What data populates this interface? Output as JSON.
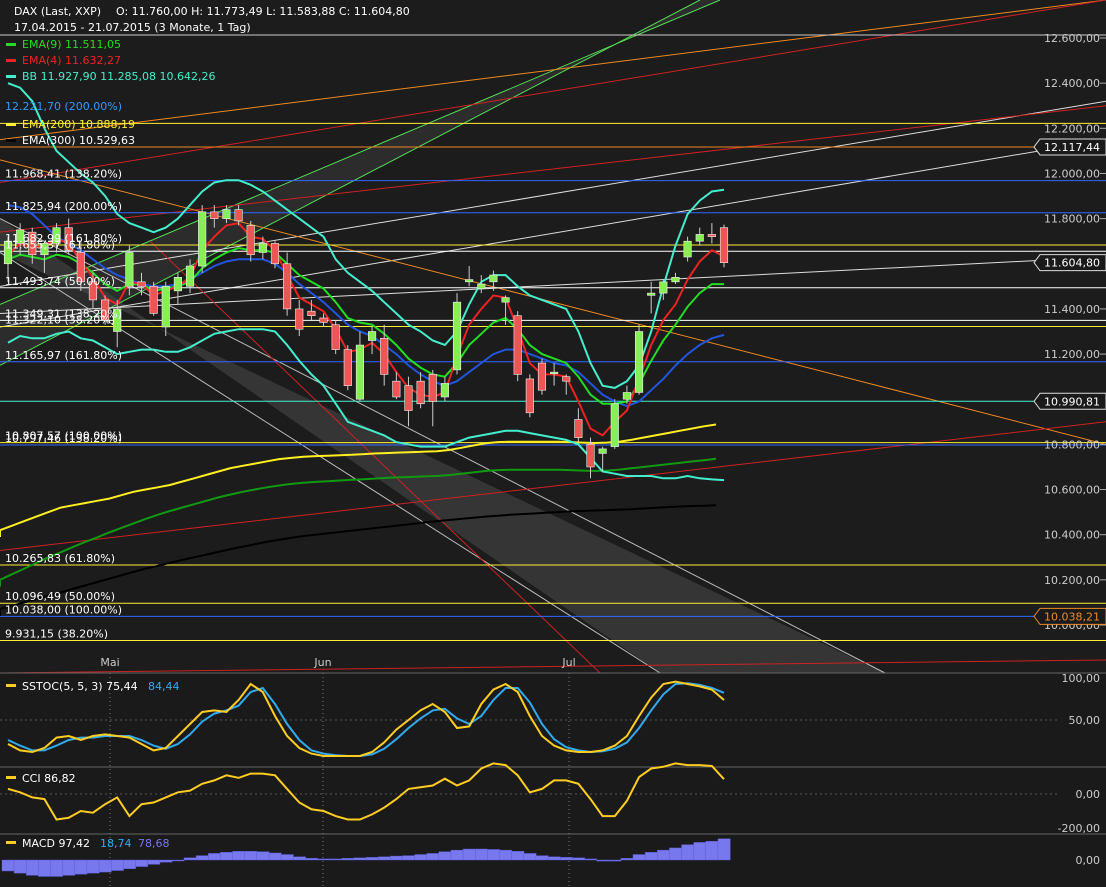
{
  "header": {
    "symbol": "DAX (Last, XXP)",
    "ohlc": "O: 11.760,00  H: 11.773,49  L: 11.583,88  C: 11.604,80",
    "period": "17.04.2015 - 21.07.2015 (3 Monate, 1 Tag)"
  },
  "legend": [
    {
      "label": "EMA(9)",
      "value": "11.511,05",
      "color": "#22dd22"
    },
    {
      "label": "EMA(4)",
      "value": "11.632,27",
      "color": "#ee2222"
    },
    {
      "label": "BB",
      "value": "11.927,90",
      "value2": "11.285,08",
      "value3": "10.642,26",
      "color": "#44eecc"
    },
    {
      "label": "EMA(200)",
      "value": "10.888,19",
      "color": "#ffee33"
    },
    {
      "label": "EMA(300)",
      "value": "10.529,63",
      "color": "#111111"
    }
  ],
  "legend_extra": "12.221,70 (200.00%)",
  "level_labels": [
    "11.968,41 (138.20%)",
    "11.825,94 (200.00%)",
    "11.682,99 (161.80%)",
    "11.655,37 (61.80%)",
    "11.493,74 (50.00%)",
    "11.349,31 (138.20%)",
    "11.322,10 (38.20%)",
    "11.165,97 (161.80%)",
    "10.807,57 (100.00%)",
    "10.797,46 (138.20%)",
    "10.265,83 (61.80%)",
    "10.096,49 (50.00%)",
    "10.038,00 (100.00%)",
    "9.931,15 (38.20%)"
  ],
  "price_boxes": [
    {
      "value": "12.117,44",
      "price": 12117.44
    },
    {
      "value": "11.604,80",
      "price": 11604.8
    },
    {
      "value": "10.990,81",
      "price": 10990.81
    },
    {
      "value": "10.038,21",
      "price": 10038.21
    }
  ],
  "months": [
    "Mai",
    "Jun",
    "Jul"
  ],
  "indicators": {
    "sstoc": {
      "label": "SSTOC(5, 5, 3)",
      "v1": "75,44",
      "v2": "84,44",
      "ticks": [
        "100,00",
        "50,00"
      ]
    },
    "cci": {
      "label": "CCI",
      "v1": "86,82",
      "ticks": [
        "0,00",
        "-200,00"
      ]
    },
    "macd": {
      "label": "MACD",
      "v1": "97,42",
      "v2": "18,74",
      "v3": "78,68",
      "ticks": [
        "0,00"
      ]
    }
  },
  "chart_data": {
    "type": "candlestick",
    "title": "DAX (Last, XXP)",
    "ylim": [
      9800,
      12800
    ],
    "yticks": [
      "12.600,00",
      "12.400,00",
      "12.200,00",
      "12.000,00",
      "11.800,00",
      "11.600,00",
      "11.400,00",
      "11.200,00",
      "11.000,00",
      "10.800,00",
      "10.600,00",
      "10.400,00",
      "10.200,00",
      "10.000,00"
    ],
    "horizontal_levels": [
      {
        "price": 12221.7,
        "color": "#ffee33"
      },
      {
        "price": 12117.44,
        "color": "#ee8822"
      },
      {
        "price": 11968.41,
        "color": "#3366ff"
      },
      {
        "price": 11825.94,
        "color": "#3366ff"
      },
      {
        "price": 11682.99,
        "color": "#ffee33"
      },
      {
        "price": 11655.37,
        "color": "#ffffff"
      },
      {
        "price": 11493.74,
        "color": "#ffffff"
      },
      {
        "price": 11349.31,
        "color": "#ffffff"
      },
      {
        "price": 11322.1,
        "color": "#ffee33"
      },
      {
        "price": 11165.97,
        "color": "#3366ff"
      },
      {
        "price": 10990.81,
        "color": "#44eecc"
      },
      {
        "price": 10807.57,
        "color": "#ffee33"
      },
      {
        "price": 10797.46,
        "color": "#3366ff"
      },
      {
        "price": 10265.83,
        "color": "#ffee33"
      },
      {
        "price": 10096.49,
        "color": "#ffee33"
      },
      {
        "price": 10038.0,
        "color": "#3366ff"
      },
      {
        "price": 9931.15,
        "color": "#ffee33"
      }
    ],
    "candles": [
      {
        "o": 11600,
        "h": 11720,
        "l": 11520,
        "c": 11700
      },
      {
        "o": 11690,
        "h": 11780,
        "l": 11640,
        "c": 11750
      },
      {
        "o": 11740,
        "h": 11760,
        "l": 11600,
        "c": 11640
      },
      {
        "o": 11640,
        "h": 11700,
        "l": 11560,
        "c": 11690
      },
      {
        "o": 11690,
        "h": 11780,
        "l": 11650,
        "c": 11760
      },
      {
        "o": 11760,
        "h": 11800,
        "l": 11640,
        "c": 11660
      },
      {
        "o": 11650,
        "h": 11700,
        "l": 11480,
        "c": 11520
      },
      {
        "o": 11520,
        "h": 11560,
        "l": 11400,
        "c": 11440
      },
      {
        "o": 11440,
        "h": 11460,
        "l": 11330,
        "c": 11350
      },
      {
        "o": 11300,
        "h": 11440,
        "l": 11230,
        "c": 11400
      },
      {
        "o": 11500,
        "h": 11680,
        "l": 11460,
        "c": 11650
      },
      {
        "o": 11520,
        "h": 11560,
        "l": 11460,
        "c": 11500
      },
      {
        "o": 11500,
        "h": 11520,
        "l": 11370,
        "c": 11380
      },
      {
        "o": 11320,
        "h": 11520,
        "l": 11280,
        "c": 11500
      },
      {
        "o": 11480,
        "h": 11560,
        "l": 11420,
        "c": 11540
      },
      {
        "o": 11500,
        "h": 11620,
        "l": 11470,
        "c": 11590
      },
      {
        "o": 11590,
        "h": 11860,
        "l": 11560,
        "c": 11830
      },
      {
        "o": 11830,
        "h": 11860,
        "l": 11760,
        "c": 11800
      },
      {
        "o": 11800,
        "h": 11860,
        "l": 11780,
        "c": 11840
      },
      {
        "o": 11840,
        "h": 11860,
        "l": 11770,
        "c": 11790
      },
      {
        "o": 11770,
        "h": 11790,
        "l": 11610,
        "c": 11640
      },
      {
        "o": 11650,
        "h": 11720,
        "l": 11620,
        "c": 11690
      },
      {
        "o": 11690,
        "h": 11700,
        "l": 11580,
        "c": 11600
      },
      {
        "o": 11600,
        "h": 11650,
        "l": 11370,
        "c": 11400
      },
      {
        "o": 11400,
        "h": 11440,
        "l": 11280,
        "c": 11310
      },
      {
        "o": 11390,
        "h": 11440,
        "l": 11350,
        "c": 11370
      },
      {
        "o": 11360,
        "h": 11380,
        "l": 11320,
        "c": 11340
      },
      {
        "o": 11330,
        "h": 11350,
        "l": 11200,
        "c": 11220
      },
      {
        "o": 11220,
        "h": 11240,
        "l": 11040,
        "c": 11060
      },
      {
        "o": 11000,
        "h": 11300,
        "l": 10990,
        "c": 11240
      },
      {
        "o": 11260,
        "h": 11320,
        "l": 11200,
        "c": 11300
      },
      {
        "o": 11270,
        "h": 11330,
        "l": 11060,
        "c": 11110
      },
      {
        "o": 11080,
        "h": 11120,
        "l": 11000,
        "c": 11010
      },
      {
        "o": 11060,
        "h": 11100,
        "l": 10880,
        "c": 10950
      },
      {
        "o": 11080,
        "h": 11120,
        "l": 10960,
        "c": 10980
      },
      {
        "o": 11110,
        "h": 11130,
        "l": 10880,
        "c": 10990
      },
      {
        "o": 11010,
        "h": 11100,
        "l": 10990,
        "c": 11070
      },
      {
        "o": 11130,
        "h": 11470,
        "l": 11110,
        "c": 11430
      },
      {
        "o": 11520,
        "h": 11590,
        "l": 11500,
        "c": 11530
      },
      {
        "o": 11490,
        "h": 11550,
        "l": 11470,
        "c": 11510
      },
      {
        "o": 11520,
        "h": 11570,
        "l": 11480,
        "c": 11550
      },
      {
        "o": 11430,
        "h": 11460,
        "l": 11330,
        "c": 11450
      },
      {
        "o": 11370,
        "h": 11390,
        "l": 11080,
        "c": 11110
      },
      {
        "o": 11090,
        "h": 11110,
        "l": 10920,
        "c": 10940
      },
      {
        "o": 11160,
        "h": 11180,
        "l": 11020,
        "c": 11040
      },
      {
        "o": 11120,
        "h": 11160,
        "l": 11060,
        "c": 11120
      },
      {
        "o": 11100,
        "h": 11110,
        "l": 11020,
        "c": 11080
      },
      {
        "o": 10910,
        "h": 10960,
        "l": 10810,
        "c": 10830
      },
      {
        "o": 10800,
        "h": 10830,
        "l": 10650,
        "c": 10700
      },
      {
        "o": 10760,
        "h": 10790,
        "l": 10680,
        "c": 10780
      },
      {
        "o": 10790,
        "h": 11000,
        "l": 10780,
        "c": 10980
      },
      {
        "o": 11000,
        "h": 11060,
        "l": 10980,
        "c": 11030
      },
      {
        "o": 11030,
        "h": 11330,
        "l": 11020,
        "c": 11300
      },
      {
        "o": 11460,
        "h": 11520,
        "l": 11380,
        "c": 11470
      },
      {
        "o": 11470,
        "h": 11530,
        "l": 11440,
        "c": 11520
      },
      {
        "o": 11520,
        "h": 11560,
        "l": 11510,
        "c": 11540
      },
      {
        "o": 11630,
        "h": 11720,
        "l": 11610,
        "c": 11700
      },
      {
        "o": 11700,
        "h": 11760,
        "l": 11680,
        "c": 11730
      },
      {
        "o": 11730,
        "h": 11780,
        "l": 11690,
        "c": 11720
      },
      {
        "o": 11760,
        "h": 11773.49,
        "l": 11583.88,
        "c": 11604.8
      }
    ],
    "ema9": [
      11620,
      11640,
      11630,
      11620,
      11640,
      11630,
      11600,
      11560,
      11510,
      11480,
      11510,
      11510,
      11480,
      11490,
      11500,
      11520,
      11580,
      11620,
      11650,
      11670,
      11660,
      11660,
      11650,
      11600,
      11550,
      11520,
      11490,
      11430,
      11360,
      11340,
      11330,
      11290,
      11240,
      11180,
      11140,
      11110,
      11100,
      11160,
      11240,
      11290,
      11340,
      11360,
      11310,
      11240,
      11200,
      11180,
      11160,
      11100,
      11020,
      10980,
      10980,
      10990,
      11070,
      11170,
      11260,
      11330,
      11410,
      11470,
      11510,
      11510
    ],
    "ema4": [
      11640,
      11690,
      11670,
      11680,
      11710,
      11690,
      11610,
      11540,
      11450,
      11420,
      11520,
      11510,
      11460,
      11480,
      11500,
      11540,
      11660,
      11720,
      11770,
      11780,
      11720,
      11710,
      11660,
      11550,
      11450,
      11420,
      11390,
      11310,
      11210,
      11220,
      11250,
      11200,
      11120,
      11050,
      11020,
      11010,
      11030,
      11190,
      11330,
      11400,
      11460,
      11450,
      11310,
      11160,
      11110,
      11110,
      11100,
      10990,
      10870,
      10840,
      10900,
      10950,
      11090,
      11240,
      11350,
      11420,
      11530,
      11610,
      11660,
      11632
    ],
    "bb_upper": [
      12400,
      12380,
      12320,
      12200,
      12100,
      12050,
      12000,
      11960,
      11900,
      11820,
      11780,
      11760,
      11740,
      11760,
      11800,
      11860,
      11920,
      11960,
      11970,
      11970,
      11950,
      11920,
      11880,
      11840,
      11800,
      11760,
      11720,
      11620,
      11560,
      11520,
      11480,
      11430,
      11380,
      11330,
      11300,
      11260,
      11240,
      11300,
      11420,
      11520,
      11550,
      11550,
      11500,
      11460,
      11440,
      11420,
      11400,
      11300,
      11160,
      11060,
      11050,
      11080,
      11150,
      11300,
      11500,
      11680,
      11820,
      11880,
      11920,
      11928
    ],
    "bb_lower": [
      11250,
      11280,
      11270,
      11270,
      11290,
      11300,
      11270,
      11260,
      11230,
      11200,
      11210,
      11220,
      11220,
      11210,
      11210,
      11230,
      11260,
      11290,
      11300,
      11310,
      11310,
      11310,
      11300,
      11240,
      11170,
      11110,
      11060,
      10980,
      10900,
      10880,
      10860,
      10840,
      10810,
      10800,
      10790,
      10790,
      10790,
      10810,
      10830,
      10840,
      10850,
      10860,
      10860,
      10850,
      10840,
      10830,
      10820,
      10800,
      10740,
      10680,
      10670,
      10660,
      10660,
      10660,
      10650,
      10650,
      10660,
      10650,
      10645,
      10642
    ],
    "bb_mid": [
      11860,
      11850,
      11820,
      11770,
      11720,
      11690,
      11660,
      11620,
      11580,
      11550,
      11530,
      11510,
      11500,
      11500,
      11510,
      11530,
      11560,
      11590,
      11610,
      11620,
      11620,
      11620,
      11600,
      11560,
      11510,
      11470,
      11430,
      11380,
      11330,
      11300,
      11280,
      11240,
      11200,
      11150,
      11110,
      11080,
      11060,
      11080,
      11120,
      11160,
      11200,
      11220,
      11220,
      11200,
      11180,
      11160,
      11150,
      11120,
      11070,
      11020,
      10990,
      10970,
      10990,
      11040,
      11090,
      11150,
      11200,
      11240,
      11270,
      11285
    ],
    "ema200": [
      10420,
      10440,
      10460,
      10480,
      10500,
      10520,
      10530,
      10540,
      10550,
      10560,
      10575,
      10590,
      10600,
      10610,
      10620,
      10635,
      10650,
      10665,
      10680,
      10695,
      10705,
      10715,
      10725,
      10735,
      10740,
      10745,
      10748,
      10750,
      10752,
      10754,
      10757,
      10760,
      10762,
      10764,
      10766,
      10768,
      10770,
      10775,
      10785,
      10795,
      10805,
      10810,
      10812,
      10812,
      10812,
      10812,
      10812,
      10810,
      10808,
      10806,
      10808,
      10812,
      10820,
      10830,
      10840,
      10850,
      10860,
      10870,
      10880,
      10888
    ],
    "ema300": [
      10070,
      10085,
      10100,
      10115,
      10130,
      10145,
      10160,
      10175,
      10190,
      10205,
      10220,
      10235,
      10250,
      10262,
      10275,
      10288,
      10300,
      10312,
      10324,
      10336,
      10347,
      10358,
      10368,
      10378,
      10386,
      10394,
      10400,
      10406,
      10412,
      10418,
      10424,
      10430,
      10436,
      10442,
      10448,
      10454,
      10460,
      10465,
      10470,
      10475,
      10480,
      10484,
      10488,
      10491,
      10494,
      10497,
      10500,
      10503,
      10505,
      10507,
      10509,
      10511,
      10513,
      10516,
      10519,
      10522,
      10525,
      10527,
      10528,
      10530
    ],
    "ema100": [
      10200,
      10225,
      10250,
      10275,
      10300,
      10322,
      10345,
      10367,
      10388,
      10410,
      10430,
      10450,
      10470,
      10488,
      10505,
      10520,
      10535,
      10550,
      10565,
      10578,
      10590,
      10600,
      10610,
      10618,
      10625,
      10630,
      10634,
      10637,
      10640,
      10643,
      10646,
      10649,
      10652,
      10654,
      10656,
      10658,
      10660,
      10664,
      10670,
      10676,
      10682,
      10686,
      10688,
      10688,
      10688,
      10688,
      10688,
      10686,
      10684,
      10682,
      10684,
      10688,
      10694,
      10700,
      10706,
      10712,
      10718,
      10724,
      10730,
      10736
    ],
    "sstoc_k": [
      20,
      12,
      10,
      15,
      28,
      30,
      25,
      30,
      32,
      30,
      28,
      20,
      12,
      15,
      30,
      45,
      60,
      62,
      60,
      75,
      95,
      85,
      55,
      30,
      15,
      8,
      5,
      5,
      5,
      5,
      10,
      22,
      38,
      50,
      62,
      70,
      60,
      40,
      42,
      70,
      88,
      95,
      85,
      55,
      30,
      18,
      12,
      10,
      10,
      12,
      18,
      30,
      55,
      78,
      95,
      98,
      95,
      92,
      88,
      75
    ],
    "sstoc_d": [
      25,
      18,
      12,
      12,
      18,
      25,
      28,
      28,
      30,
      30,
      30,
      25,
      18,
      14,
      20,
      32,
      48,
      58,
      62,
      68,
      85,
      90,
      70,
      45,
      25,
      12,
      8,
      6,
      5,
      5,
      7,
      14,
      26,
      40,
      52,
      62,
      64,
      52,
      45,
      55,
      75,
      90,
      90,
      72,
      45,
      26,
      16,
      12,
      10,
      11,
      14,
      22,
      40,
      62,
      82,
      95,
      96,
      94,
      90,
      84
    ],
    "cci": [
      30,
      10,
      -20,
      -30,
      -150,
      -140,
      -100,
      -110,
      -60,
      -20,
      -130,
      -60,
      -50,
      -20,
      10,
      20,
      60,
      80,
      110,
      95,
      120,
      120,
      110,
      30,
      -50,
      -90,
      -100,
      -130,
      -150,
      -150,
      -120,
      -80,
      -30,
      30,
      40,
      50,
      90,
      50,
      80,
      150,
      180,
      170,
      110,
      10,
      30,
      80,
      80,
      60,
      -30,
      -130,
      -130,
      -40,
      100,
      150,
      160,
      180,
      170,
      170,
      165,
      87
    ],
    "macd": [
      -50,
      -60,
      -70,
      -75,
      -75,
      -70,
      -65,
      -60,
      -55,
      -48,
      -40,
      -30,
      -20,
      -10,
      0,
      10,
      20,
      30,
      35,
      40,
      40,
      38,
      32,
      25,
      15,
      8,
      5,
      5,
      8,
      10,
      12,
      15,
      18,
      20,
      25,
      30,
      38,
      45,
      50,
      50,
      48,
      45,
      40,
      30,
      20,
      15,
      12,
      10,
      5,
      -5,
      -5,
      8,
      25,
      35,
      45,
      55,
      70,
      80,
      85,
      97
    ]
  }
}
